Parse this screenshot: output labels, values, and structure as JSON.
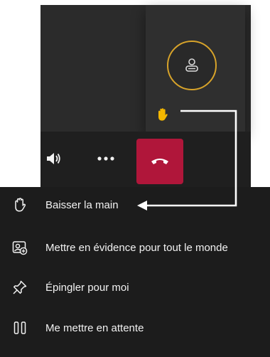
{
  "menu": {
    "items": [
      {
        "label": "Baisser la main",
        "icon": "hand-icon"
      },
      {
        "label": "Mettre en évidence pour tout le monde",
        "icon": "spotlight-icon"
      },
      {
        "label": "Épingler pour moi",
        "icon": "pin-icon"
      },
      {
        "label": "Me mettre en attente",
        "icon": "pause-icon"
      }
    ]
  },
  "call": {
    "avatar_icon": "person-icon",
    "raised_hand_icon": "raised-hand-icon",
    "controls": [
      "speaker-icon",
      "more-options-icon",
      "hang-up-icon"
    ]
  },
  "colors": {
    "avatar_ring": "#d7a32a",
    "raised_hand": "#f5b800",
    "hangup": "#b0163a",
    "menu_bg": "#1c1c1c"
  }
}
